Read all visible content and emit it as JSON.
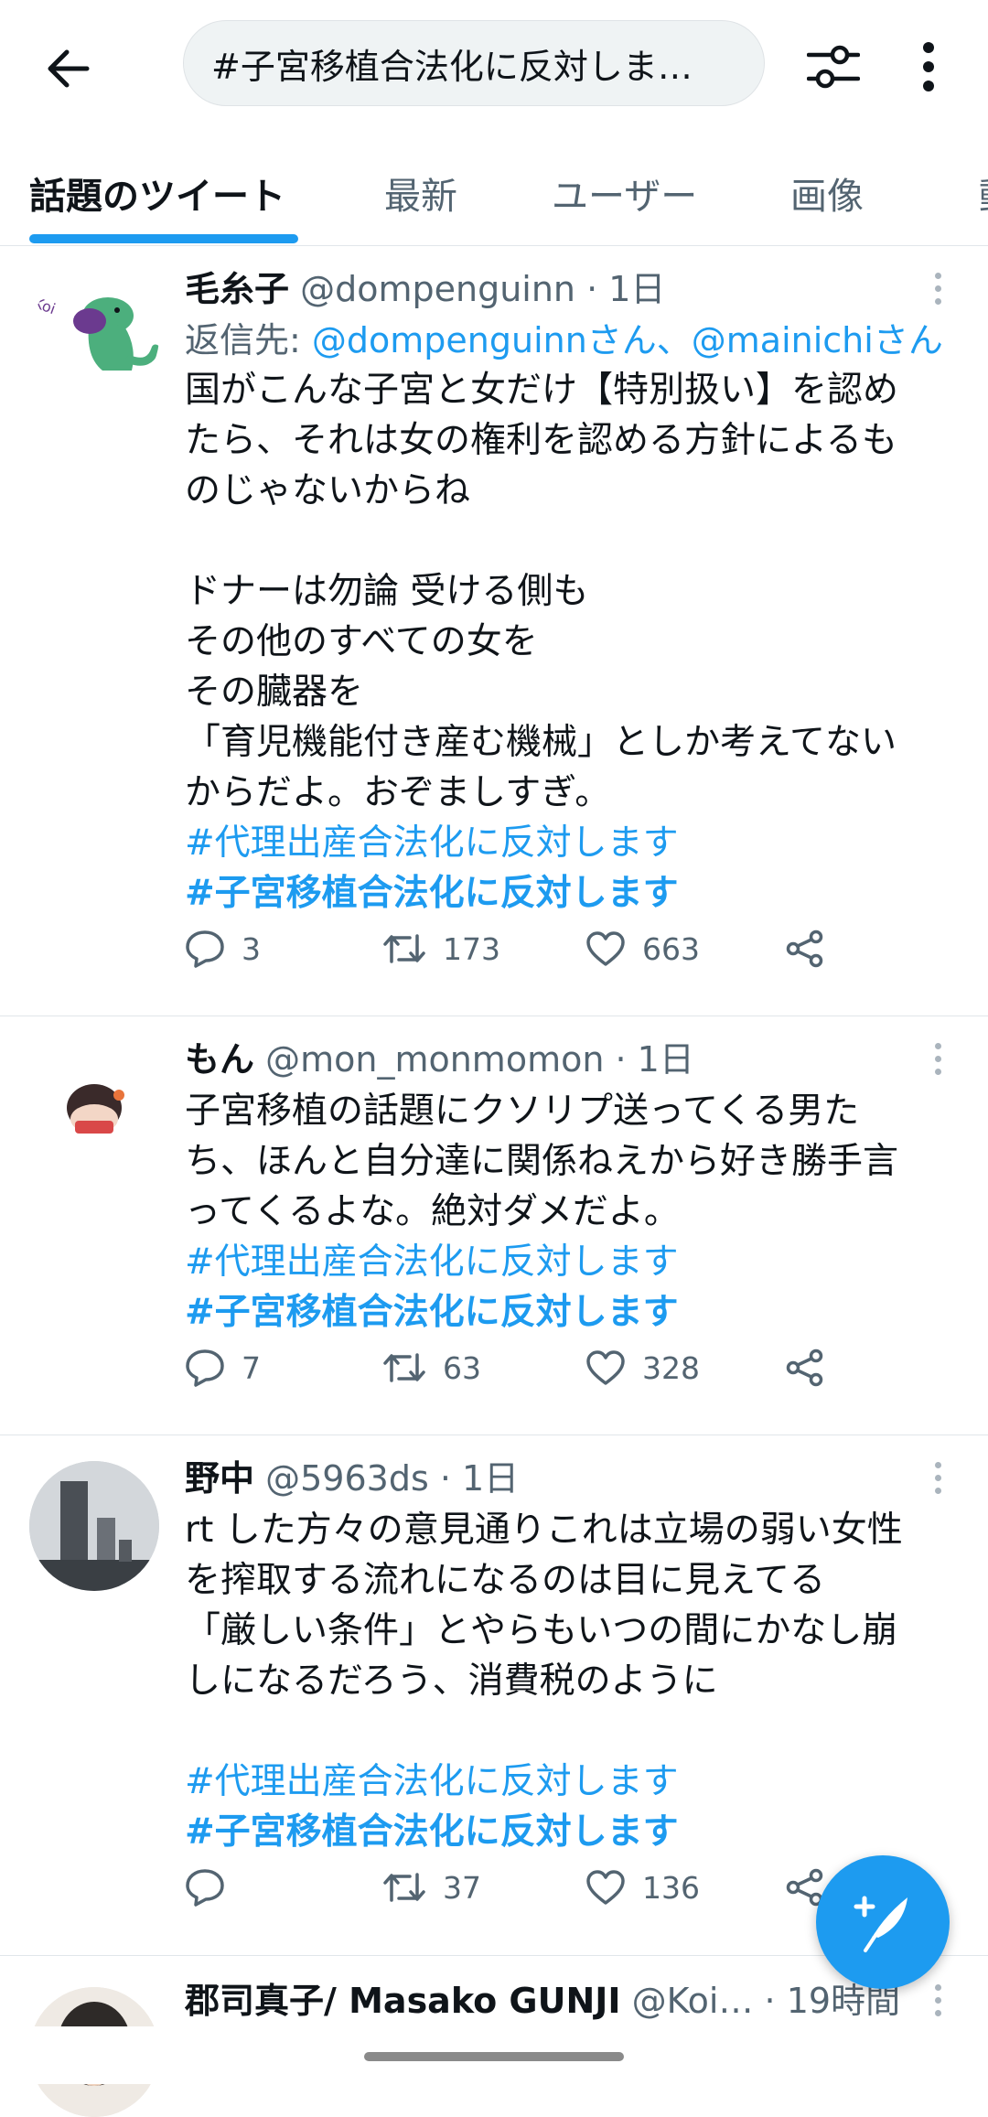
{
  "search": {
    "query": "#子宮移植合法化に反対しま…"
  },
  "tabs": [
    {
      "label": "話題のツイート",
      "active": true
    },
    {
      "label": "最新"
    },
    {
      "label": "ユーザー"
    },
    {
      "label": "画像"
    }
  ],
  "tweets": [
    {
      "name": "毛糸子",
      "handle": "@dompenguinn · 1日",
      "reply_prefix": "返信先: ",
      "reply_targets": "@dompenguinnさん、@mainichiさん",
      "lines": [
        "国がこんな子宮と女だけ【特別扱い】を認め",
        "たら、それは女の権利を認める方針によるも",
        "のじゃないからね",
        "",
        "ドナーは勿論 受ける側も",
        "その他のすべての女を",
        "その臓器を",
        "「育児機能付き産む機械」としか考えてない",
        "からだよ。おぞましすぎ。"
      ],
      "hashtag1": "#代理出産合法化に反対します",
      "hashtag2": "#子宮移植合法化に反対します",
      "replies": "3",
      "retweets": "173",
      "likes": "663"
    },
    {
      "name": "もん",
      "handle": "@mon_monmomon · 1日",
      "lines": [
        "子宮移植の話題にクソリプ送ってくる男た",
        "ち、ほんと自分達に関係ねえから好き勝手言",
        "ってくるよな。絶対ダメだよ。"
      ],
      "hashtag1": "#代理出産合法化に反対します",
      "hashtag2": "#子宮移植合法化に反対します",
      "replies": "7",
      "retweets": "63",
      "likes": "328"
    },
    {
      "name": "野中",
      "handle": "@5963ds · 1日",
      "lines": [
        "rt した方々の意見通りこれは立場の弱い女性",
        "を搾取する流れになるのは目に見えてる",
        "「厳しい条件」とやらもいつの間にかなし崩",
        "しになるだろう、消費税のように",
        ""
      ],
      "hashtag1": "#代理出産合法化に反対します",
      "hashtag2": "#子宮移植合法化に反対します",
      "replies": "",
      "retweets": "37",
      "likes": "136"
    },
    {
      "name": "郡司真子/ Masako GUNJI",
      "handle": "@Koi… · 19時間"
    }
  ],
  "colors": {
    "accent": "#1d9bf0",
    "secondary_text": "#536471"
  }
}
